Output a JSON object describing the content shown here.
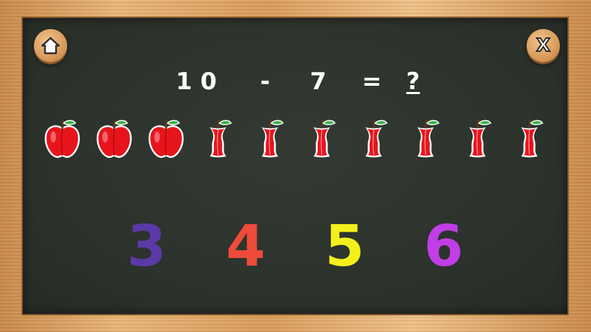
{
  "toolbar": {
    "home_icon": "home-icon",
    "close_label": "X"
  },
  "equation": {
    "operand1": "1 0",
    "operator": "-",
    "operand2": "7",
    "equals": "=",
    "unknown": "?"
  },
  "apples": [
    {
      "state": "whole"
    },
    {
      "state": "whole"
    },
    {
      "state": "whole"
    },
    {
      "state": "eaten"
    },
    {
      "state": "eaten"
    },
    {
      "state": "eaten"
    },
    {
      "state": "eaten"
    },
    {
      "state": "eaten"
    },
    {
      "state": "eaten"
    },
    {
      "state": "eaten"
    }
  ],
  "answers": [
    {
      "label": "3",
      "color": "#5b3aa8"
    },
    {
      "label": "4",
      "color": "#ee4b3a"
    },
    {
      "label": "5",
      "color": "#f3f01c"
    },
    {
      "label": "6",
      "color": "#c13ee6"
    }
  ],
  "colors": {
    "board": "#2f352f",
    "apple_red": "#e8141c",
    "leaf_green": "#3bb44a"
  }
}
